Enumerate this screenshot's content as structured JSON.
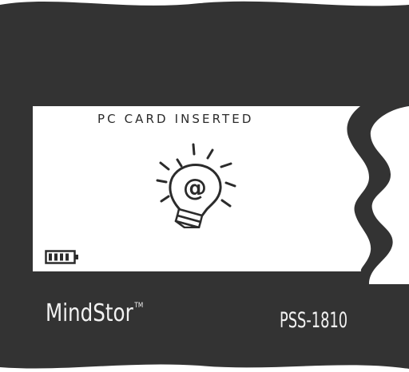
{
  "screen": {
    "status_text": "PC CARD INSERTED",
    "icon": "lightbulb-at-icon",
    "battery_icon": "battery-full-icon"
  },
  "device": {
    "brand": "MindStor",
    "trademark": "TM",
    "model": "PSS-1810"
  },
  "colors": {
    "casing": "#333333",
    "screen": "#ffffff",
    "ink": "#2b2b2b",
    "label": "#f2f2f2"
  }
}
